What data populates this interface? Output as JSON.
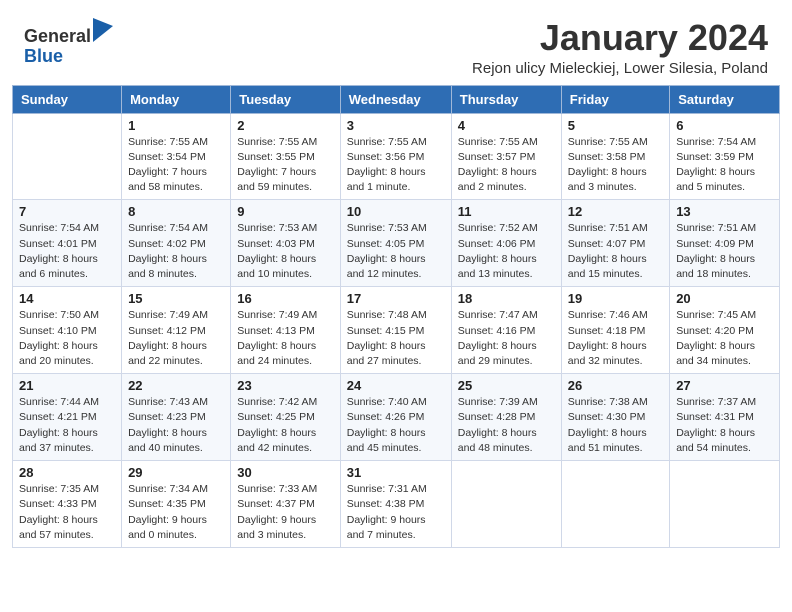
{
  "header": {
    "logo_general": "General",
    "logo_blue": "Blue",
    "month_title": "January 2024",
    "subtitle": "Rejon ulicy Mieleckiej, Lower Silesia, Poland"
  },
  "days_of_week": [
    "Sunday",
    "Monday",
    "Tuesday",
    "Wednesday",
    "Thursday",
    "Friday",
    "Saturday"
  ],
  "weeks": [
    [
      {
        "day": "",
        "info": ""
      },
      {
        "day": "1",
        "info": "Sunrise: 7:55 AM\nSunset: 3:54 PM\nDaylight: 7 hours\nand 58 minutes."
      },
      {
        "day": "2",
        "info": "Sunrise: 7:55 AM\nSunset: 3:55 PM\nDaylight: 7 hours\nand 59 minutes."
      },
      {
        "day": "3",
        "info": "Sunrise: 7:55 AM\nSunset: 3:56 PM\nDaylight: 8 hours\nand 1 minute."
      },
      {
        "day": "4",
        "info": "Sunrise: 7:55 AM\nSunset: 3:57 PM\nDaylight: 8 hours\nand 2 minutes."
      },
      {
        "day": "5",
        "info": "Sunrise: 7:55 AM\nSunset: 3:58 PM\nDaylight: 8 hours\nand 3 minutes."
      },
      {
        "day": "6",
        "info": "Sunrise: 7:54 AM\nSunset: 3:59 PM\nDaylight: 8 hours\nand 5 minutes."
      }
    ],
    [
      {
        "day": "7",
        "info": "Sunrise: 7:54 AM\nSunset: 4:01 PM\nDaylight: 8 hours\nand 6 minutes."
      },
      {
        "day": "8",
        "info": "Sunrise: 7:54 AM\nSunset: 4:02 PM\nDaylight: 8 hours\nand 8 minutes."
      },
      {
        "day": "9",
        "info": "Sunrise: 7:53 AM\nSunset: 4:03 PM\nDaylight: 8 hours\nand 10 minutes."
      },
      {
        "day": "10",
        "info": "Sunrise: 7:53 AM\nSunset: 4:05 PM\nDaylight: 8 hours\nand 12 minutes."
      },
      {
        "day": "11",
        "info": "Sunrise: 7:52 AM\nSunset: 4:06 PM\nDaylight: 8 hours\nand 13 minutes."
      },
      {
        "day": "12",
        "info": "Sunrise: 7:51 AM\nSunset: 4:07 PM\nDaylight: 8 hours\nand 15 minutes."
      },
      {
        "day": "13",
        "info": "Sunrise: 7:51 AM\nSunset: 4:09 PM\nDaylight: 8 hours\nand 18 minutes."
      }
    ],
    [
      {
        "day": "14",
        "info": "Sunrise: 7:50 AM\nSunset: 4:10 PM\nDaylight: 8 hours\nand 20 minutes."
      },
      {
        "day": "15",
        "info": "Sunrise: 7:49 AM\nSunset: 4:12 PM\nDaylight: 8 hours\nand 22 minutes."
      },
      {
        "day": "16",
        "info": "Sunrise: 7:49 AM\nSunset: 4:13 PM\nDaylight: 8 hours\nand 24 minutes."
      },
      {
        "day": "17",
        "info": "Sunrise: 7:48 AM\nSunset: 4:15 PM\nDaylight: 8 hours\nand 27 minutes."
      },
      {
        "day": "18",
        "info": "Sunrise: 7:47 AM\nSunset: 4:16 PM\nDaylight: 8 hours\nand 29 minutes."
      },
      {
        "day": "19",
        "info": "Sunrise: 7:46 AM\nSunset: 4:18 PM\nDaylight: 8 hours\nand 32 minutes."
      },
      {
        "day": "20",
        "info": "Sunrise: 7:45 AM\nSunset: 4:20 PM\nDaylight: 8 hours\nand 34 minutes."
      }
    ],
    [
      {
        "day": "21",
        "info": "Sunrise: 7:44 AM\nSunset: 4:21 PM\nDaylight: 8 hours\nand 37 minutes."
      },
      {
        "day": "22",
        "info": "Sunrise: 7:43 AM\nSunset: 4:23 PM\nDaylight: 8 hours\nand 40 minutes."
      },
      {
        "day": "23",
        "info": "Sunrise: 7:42 AM\nSunset: 4:25 PM\nDaylight: 8 hours\nand 42 minutes."
      },
      {
        "day": "24",
        "info": "Sunrise: 7:40 AM\nSunset: 4:26 PM\nDaylight: 8 hours\nand 45 minutes."
      },
      {
        "day": "25",
        "info": "Sunrise: 7:39 AM\nSunset: 4:28 PM\nDaylight: 8 hours\nand 48 minutes."
      },
      {
        "day": "26",
        "info": "Sunrise: 7:38 AM\nSunset: 4:30 PM\nDaylight: 8 hours\nand 51 minutes."
      },
      {
        "day": "27",
        "info": "Sunrise: 7:37 AM\nSunset: 4:31 PM\nDaylight: 8 hours\nand 54 minutes."
      }
    ],
    [
      {
        "day": "28",
        "info": "Sunrise: 7:35 AM\nSunset: 4:33 PM\nDaylight: 8 hours\nand 57 minutes."
      },
      {
        "day": "29",
        "info": "Sunrise: 7:34 AM\nSunset: 4:35 PM\nDaylight: 9 hours\nand 0 minutes."
      },
      {
        "day": "30",
        "info": "Sunrise: 7:33 AM\nSunset: 4:37 PM\nDaylight: 9 hours\nand 3 minutes."
      },
      {
        "day": "31",
        "info": "Sunrise: 7:31 AM\nSunset: 4:38 PM\nDaylight: 9 hours\nand 7 minutes."
      },
      {
        "day": "",
        "info": ""
      },
      {
        "day": "",
        "info": ""
      },
      {
        "day": "",
        "info": ""
      }
    ]
  ]
}
